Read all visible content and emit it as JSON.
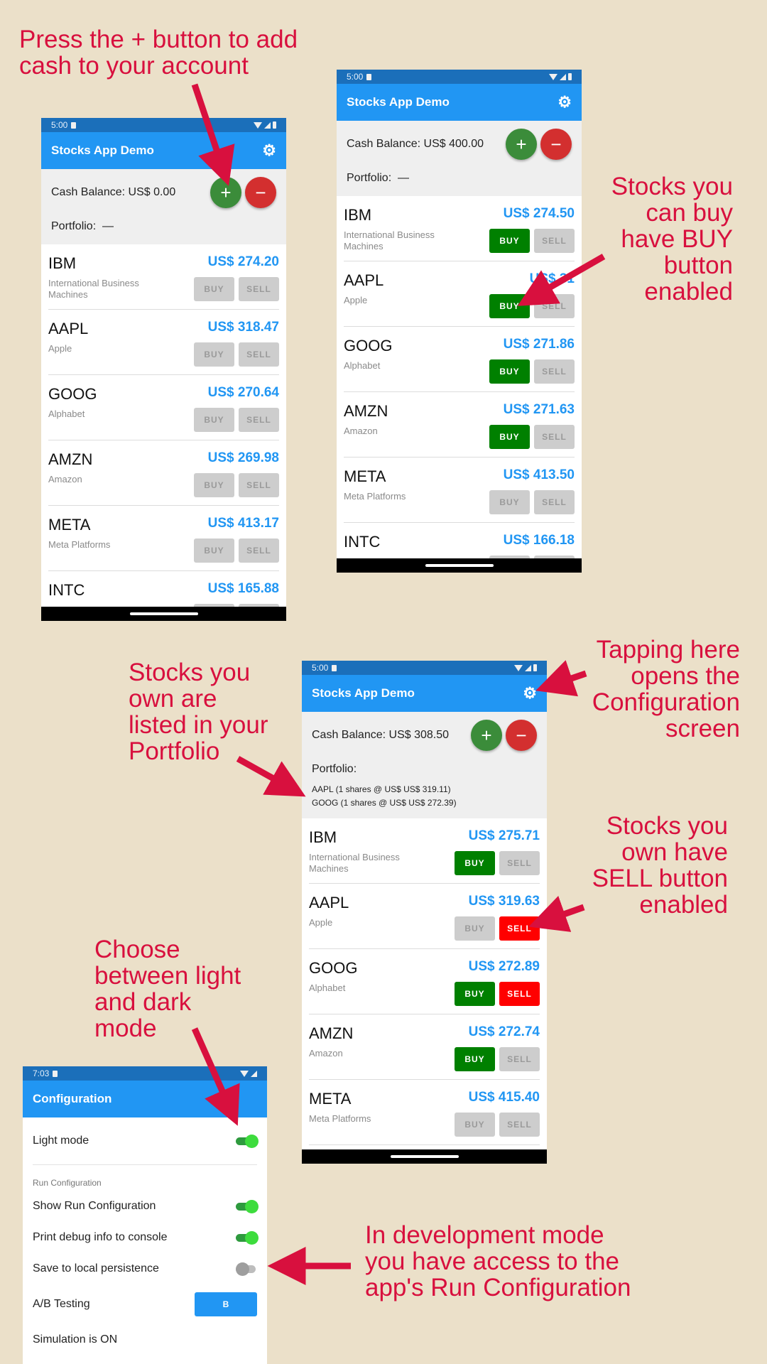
{
  "colors": {
    "annotation": "#d8103e",
    "app_bar": "#2196f3",
    "status_bar": "#1b6fba",
    "price": "#2196f3",
    "buy_enabled": "#008000",
    "sell_enabled": "#ff0000",
    "disabled": "#cdcdcd",
    "fab_add": "#3b8c3a",
    "fab_remove": "#d32f2f"
  },
  "annotations": {
    "add_cash": [
      "Press the + button to add",
      "cash to your account"
    ],
    "can_buy": [
      "Stocks you",
      "can buy",
      "have BUY",
      "button",
      "enabled"
    ],
    "portfolio": [
      "Stocks you",
      "own are",
      "listed in your",
      "Portfolio"
    ],
    "settings": [
      "Tapping here",
      "opens the",
      "Configuration",
      "screen"
    ],
    "sell": [
      "Stocks you",
      "own have",
      "SELL button",
      "enabled"
    ],
    "theme": [
      "Choose",
      "between light",
      "and dark",
      "mode"
    ],
    "dev": [
      "In development mode",
      "you have access to the",
      "app's Run Configuration"
    ]
  },
  "icons": {
    "settings": "gear-icon",
    "add": "plus-icon",
    "remove": "minus-icon",
    "wifi": "wifi-icon",
    "signal": "signal-icon",
    "battery": "battery-icon",
    "sim": "sim-card-icon"
  },
  "app": {
    "title": "Stocks App Demo",
    "portfolio_label": "Portfolio:",
    "buy": "BUY",
    "sell": "SELL",
    "add_symbol": "+",
    "remove_symbol": "−"
  },
  "phone1": {
    "time": "5:00",
    "cash": "Cash Balance: US$ 0.00",
    "portfolio_value": "—",
    "stocks": [
      {
        "symbol": "IBM",
        "name": "International Business Machines",
        "price": "US$ 274.20",
        "buy": false,
        "sell": false
      },
      {
        "symbol": "AAPL",
        "name": "Apple",
        "price": "US$ 318.47",
        "buy": false,
        "sell": false
      },
      {
        "symbol": "GOOG",
        "name": "Alphabet",
        "price": "US$ 270.64",
        "buy": false,
        "sell": false
      },
      {
        "symbol": "AMZN",
        "name": "Amazon",
        "price": "US$ 269.98",
        "buy": false,
        "sell": false
      },
      {
        "symbol": "META",
        "name": "Meta Platforms",
        "price": "US$ 413.17",
        "buy": false,
        "sell": false
      },
      {
        "symbol": "INTC",
        "name": "",
        "price": "US$ 165.88",
        "buy": false,
        "sell": false
      }
    ]
  },
  "phone2": {
    "time": "5:00",
    "cash": "Cash Balance: US$ 400.00",
    "portfolio_value": "—",
    "stocks": [
      {
        "symbol": "IBM",
        "name": "International Business Machines",
        "price": "US$ 274.50",
        "buy": true,
        "sell": false
      },
      {
        "symbol": "AAPL",
        "name": "Apple",
        "price": "US$ 31",
        "buy": true,
        "sell": false
      },
      {
        "symbol": "GOOG",
        "name": "Alphabet",
        "price": "US$ 271.86",
        "buy": true,
        "sell": false
      },
      {
        "symbol": "AMZN",
        "name": "Amazon",
        "price": "US$ 271.63",
        "buy": true,
        "sell": false
      },
      {
        "symbol": "META",
        "name": "Meta Platforms",
        "price": "US$ 413.50",
        "buy": false,
        "sell": false
      },
      {
        "symbol": "INTC",
        "name": "",
        "price": "US$ 166.18",
        "buy": false,
        "sell": false
      }
    ]
  },
  "phone3": {
    "time": "5:00",
    "cash": "Cash Balance: US$ 308.50",
    "portfolio_items": [
      "AAPL (1 shares @ US$ US$ 319.11)",
      "GOOG (1 shares @ US$ US$ 272.39)"
    ],
    "stocks": [
      {
        "symbol": "IBM",
        "name": "International Business Machines",
        "price": "US$ 275.71",
        "buy": true,
        "sell": false
      },
      {
        "symbol": "AAPL",
        "name": "Apple",
        "price": "US$ 319.63",
        "buy": false,
        "sell": true
      },
      {
        "symbol": "GOOG",
        "name": "Alphabet",
        "price": "US$ 272.89",
        "buy": true,
        "sell": true
      },
      {
        "symbol": "AMZN",
        "name": "Amazon",
        "price": "US$ 272.74",
        "buy": true,
        "sell": false
      },
      {
        "symbol": "META",
        "name": "Meta Platforms",
        "price": "US$ 415.40",
        "buy": false,
        "sell": false
      }
    ]
  },
  "config": {
    "time": "7:03",
    "title": "Configuration",
    "light_mode": "Light mode",
    "light_mode_on": true,
    "section": "Run Configuration",
    "items": [
      {
        "label": "Show Run Configuration",
        "on": true
      },
      {
        "label": "Print debug info to console",
        "on": true
      },
      {
        "label": "Save to local persistence",
        "on": false
      }
    ],
    "ab_label": "A/B Testing",
    "ab_value": "B",
    "simulation": "Simulation is ON"
  }
}
